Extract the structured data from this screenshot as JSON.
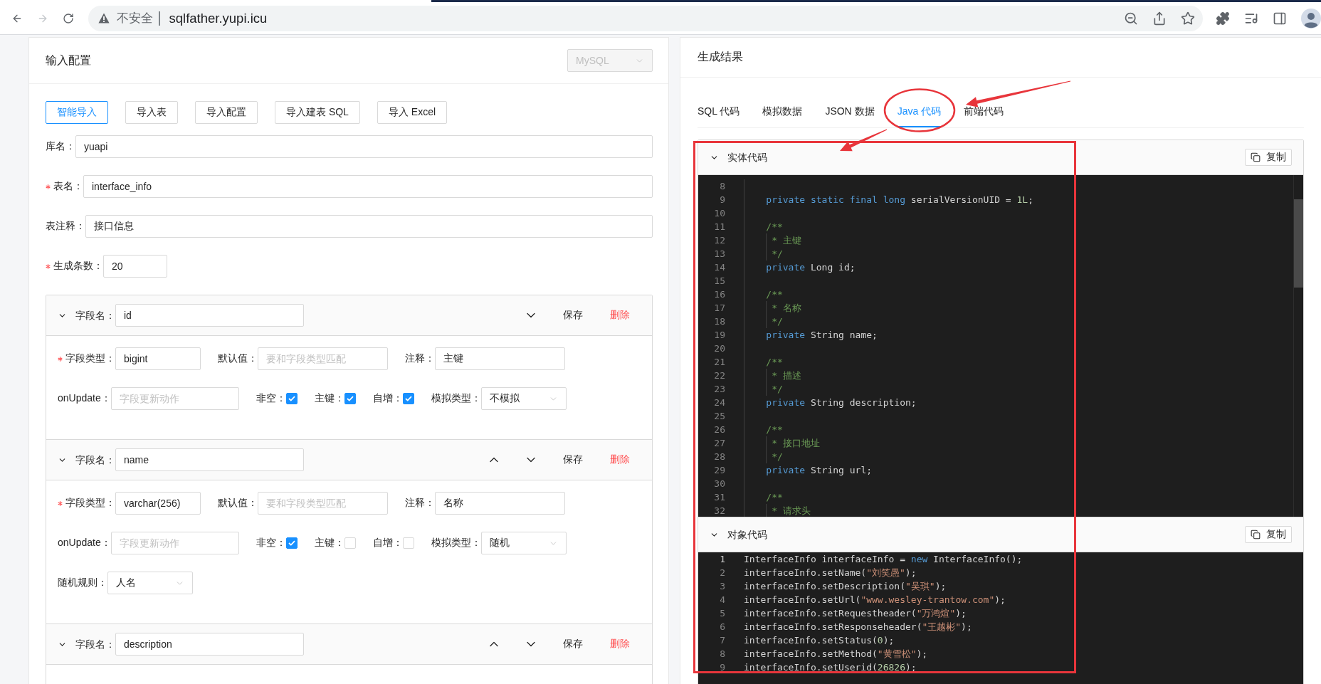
{
  "browser": {
    "navigation": [
      {
        "kind": "back",
        "disabled": false
      },
      {
        "kind": "forward",
        "disabled": true
      },
      {
        "kind": "reload",
        "disabled": false
      }
    ],
    "security_label": "不安全",
    "url": "sqlfather.yupi.icu",
    "omnibox_actions": [
      {
        "kind": "zoom_out"
      },
      {
        "kind": "share"
      },
      {
        "kind": "bookmark"
      }
    ],
    "toolbar_actions": [
      {
        "kind": "extensions"
      },
      {
        "kind": "media"
      },
      {
        "kind": "side_panel"
      },
      {
        "kind": "profile"
      }
    ]
  },
  "input_config": {
    "title": "输入配置",
    "dialect_select": {
      "value": "MySQL",
      "disabled": true
    },
    "import_buttons": [
      {
        "label": "智能导入",
        "focused": true
      },
      {
        "label": "导入表",
        "focused": false
      },
      {
        "label": "导入配置",
        "focused": false
      },
      {
        "label": "导入建表 SQL",
        "focused": false
      },
      {
        "label": "导入 Excel",
        "focused": false
      }
    ],
    "table_fields": [
      {
        "label": "库名：",
        "required": false,
        "value": "yuapi"
      },
      {
        "label": "表名：",
        "required": true,
        "value": "interface_info"
      },
      {
        "label": "表注释：",
        "required": false,
        "value": "接口信息"
      },
      {
        "label": "生成条数：",
        "required": true,
        "value": "20"
      }
    ],
    "columns": [
      {
        "name_label": "字段名：",
        "name": "id",
        "expanded": true,
        "can_move_up": false,
        "can_move_down": true,
        "save_label": "保存",
        "delete_label": "删除",
        "rows": [
          {
            "items": [
              {
                "kind": "input",
                "label": "字段类型：",
                "required": true,
                "value": "bigint"
              },
              {
                "kind": "input",
                "label": "默认值：",
                "required": false,
                "placeholder": "要和字段类型匹配"
              },
              {
                "kind": "input",
                "label": "注释：",
                "required": false,
                "value": "主键"
              }
            ]
          },
          {
            "items": [
              {
                "kind": "input",
                "label": "onUpdate：",
                "required": false,
                "placeholder": "字段更新动作"
              },
              {
                "kind": "checkbox",
                "label": "非空：",
                "checked": true
              },
              {
                "kind": "checkbox",
                "label": "主键：",
                "checked": true
              },
              {
                "kind": "checkbox",
                "label": "自增：",
                "checked": true
              },
              {
                "kind": "select",
                "label": "模拟类型：",
                "value": "不模拟"
              }
            ]
          }
        ]
      },
      {
        "name_label": "字段名：",
        "name": "name",
        "expanded": true,
        "can_move_up": true,
        "can_move_down": true,
        "save_label": "保存",
        "delete_label": "删除",
        "rows": [
          {
            "items": [
              {
                "kind": "input",
                "label": "字段类型：",
                "required": true,
                "value": "varchar(256)"
              },
              {
                "kind": "input",
                "label": "默认值：",
                "required": false,
                "placeholder": "要和字段类型匹配"
              },
              {
                "kind": "input",
                "label": "注释：",
                "required": false,
                "value": "名称"
              }
            ]
          },
          {
            "items": [
              {
                "kind": "input",
                "label": "onUpdate：",
                "required": false,
                "placeholder": "字段更新动作"
              },
              {
                "kind": "checkbox",
                "label": "非空：",
                "checked": true
              },
              {
                "kind": "checkbox",
                "label": "主键：",
                "checked": false
              },
              {
                "kind": "checkbox",
                "label": "自增：",
                "checked": false
              },
              {
                "kind": "select",
                "label": "模拟类型：",
                "value": "随机"
              }
            ]
          },
          {
            "items": [
              {
                "kind": "select",
                "label": "随机规则：",
                "value": "人名"
              }
            ]
          }
        ]
      },
      {
        "name_label": "字段名：",
        "name": "description",
        "expanded": true,
        "can_move_up": true,
        "can_move_down": true,
        "save_label": "保存",
        "delete_label": "删除"
      }
    ]
  },
  "result": {
    "title": "生成结果",
    "tabs": [
      {
        "label": "SQL 代码",
        "selected": false
      },
      {
        "label": "模拟数据",
        "selected": false
      },
      {
        "label": "JSON 数据",
        "selected": false
      },
      {
        "label": "Java 代码",
        "selected": true
      },
      {
        "label": "前端代码",
        "selected": false
      }
    ],
    "sections": [
      {
        "title": "实体代码",
        "expanded": true,
        "copy_label": "复制",
        "scrollable": true,
        "lines": [
          {
            "number": "8",
            "active": false
          },
          {
            "number": "9",
            "active": false,
            "tokens": [
              {
                "text": "    private static final long",
                "kind": "keyword"
              },
              {
                "text": " serialVersionUID = ",
                "kind": "plain"
              },
              {
                "text": "1L",
                "kind": "number"
              },
              {
                "text": ";",
                "kind": "plain"
              }
            ]
          },
          {
            "number": "10",
            "active": false
          },
          {
            "number": "11",
            "active": false,
            "tokens": [
              {
                "text": "    /**",
                "kind": "comment"
              }
            ]
          },
          {
            "number": "12",
            "active": false,
            "tokens": [
              {
                "text": "     * 主键",
                "kind": "comment"
              }
            ]
          },
          {
            "number": "13",
            "active": false,
            "tokens": [
              {
                "text": "     */",
                "kind": "comment"
              }
            ]
          },
          {
            "number": "14",
            "active": false,
            "tokens": [
              {
                "text": "    private",
                "kind": "keyword"
              },
              {
                "text": " Long id;",
                "kind": "plain"
              }
            ]
          },
          {
            "number": "15",
            "active": false
          },
          {
            "number": "16",
            "active": false,
            "tokens": [
              {
                "text": "    /**",
                "kind": "comment"
              }
            ]
          },
          {
            "number": "17",
            "active": false,
            "tokens": [
              {
                "text": "     * 名称",
                "kind": "comment"
              }
            ]
          },
          {
            "number": "18",
            "active": false,
            "tokens": [
              {
                "text": "     */",
                "kind": "comment"
              }
            ]
          },
          {
            "number": "19",
            "active": false,
            "tokens": [
              {
                "text": "    private",
                "kind": "keyword"
              },
              {
                "text": " String name;",
                "kind": "plain"
              }
            ]
          },
          {
            "number": "20",
            "active": false
          },
          {
            "number": "21",
            "active": false,
            "tokens": [
              {
                "text": "    /**",
                "kind": "comment"
              }
            ]
          },
          {
            "number": "22",
            "active": false,
            "tokens": [
              {
                "text": "     * 描述",
                "kind": "comment"
              }
            ]
          },
          {
            "number": "23",
            "active": false,
            "tokens": [
              {
                "text": "     */",
                "kind": "comment"
              }
            ]
          },
          {
            "number": "24",
            "active": false,
            "tokens": [
              {
                "text": "    private",
                "kind": "keyword"
              },
              {
                "text": " String description;",
                "kind": "plain"
              }
            ]
          },
          {
            "number": "25",
            "active": false
          },
          {
            "number": "26",
            "active": false,
            "tokens": [
              {
                "text": "    /**",
                "kind": "comment"
              }
            ]
          },
          {
            "number": "27",
            "active": false,
            "tokens": [
              {
                "text": "     * 接口地址",
                "kind": "comment"
              }
            ]
          },
          {
            "number": "28",
            "active": false,
            "tokens": [
              {
                "text": "     */",
                "kind": "comment"
              }
            ]
          },
          {
            "number": "29",
            "active": false,
            "tokens": [
              {
                "text": "    private",
                "kind": "keyword"
              },
              {
                "text": " String url;",
                "kind": "plain"
              }
            ]
          },
          {
            "number": "30",
            "active": false
          },
          {
            "number": "31",
            "active": false,
            "tokens": [
              {
                "text": "    /**",
                "kind": "comment"
              }
            ]
          },
          {
            "number": "32",
            "active": false,
            "tokens": [
              {
                "text": "     * 请求头",
                "kind": "comment"
              }
            ]
          }
        ]
      },
      {
        "title": "对象代码",
        "expanded": true,
        "copy_label": "复制",
        "scrollable": false,
        "lines": [
          {
            "number": "1",
            "active": true,
            "tokens": [
              {
                "text": "InterfaceInfo interfaceInfo = ",
                "kind": "plain"
              },
              {
                "text": "new",
                "kind": "keyword"
              },
              {
                "text": " InterfaceInfo();",
                "kind": "plain"
              }
            ]
          },
          {
            "number": "2",
            "active": false,
            "tokens": [
              {
                "text": "interfaceInfo.setName(",
                "kind": "plain"
              },
              {
                "text": "\"刘笑愚\"",
                "kind": "string"
              },
              {
                "text": ");",
                "kind": "plain"
              }
            ]
          },
          {
            "number": "3",
            "active": false,
            "tokens": [
              {
                "text": "interfaceInfo.setDescription(",
                "kind": "plain"
              },
              {
                "text": "\"吴琪\"",
                "kind": "string"
              },
              {
                "text": ");",
                "kind": "plain"
              }
            ]
          },
          {
            "number": "4",
            "active": false,
            "tokens": [
              {
                "text": "interfaceInfo.setUrl(",
                "kind": "plain"
              },
              {
                "text": "\"www.wesley-trantow.com\"",
                "kind": "string"
              },
              {
                "text": ");",
                "kind": "plain"
              }
            ]
          },
          {
            "number": "5",
            "active": false,
            "tokens": [
              {
                "text": "interfaceInfo.setRequestheader(",
                "kind": "plain"
              },
              {
                "text": "\"万鸿煊\"",
                "kind": "string"
              },
              {
                "text": ");",
                "kind": "plain"
              }
            ]
          },
          {
            "number": "6",
            "active": false,
            "tokens": [
              {
                "text": "interfaceInfo.setResponseheader(",
                "kind": "plain"
              },
              {
                "text": "\"王越彬\"",
                "kind": "string"
              },
              {
                "text": ");",
                "kind": "plain"
              }
            ]
          },
          {
            "number": "7",
            "active": false,
            "tokens": [
              {
                "text": "interfaceInfo.setStatus(",
                "kind": "plain"
              },
              {
                "text": "0",
                "kind": "number"
              },
              {
                "text": ");",
                "kind": "plain"
              }
            ]
          },
          {
            "number": "8",
            "active": false,
            "tokens": [
              {
                "text": "interfaceInfo.setMethod(",
                "kind": "plain"
              },
              {
                "text": "\"黄雪松\"",
                "kind": "string"
              },
              {
                "text": ");",
                "kind": "plain"
              }
            ]
          },
          {
            "number": "9",
            "active": false,
            "tokens": [
              {
                "text": "interfaceInfo.setUserid(",
                "kind": "plain"
              },
              {
                "text": "26826",
                "kind": "number"
              },
              {
                "text": ");",
                "kind": "plain"
              }
            ]
          }
        ]
      }
    ]
  }
}
